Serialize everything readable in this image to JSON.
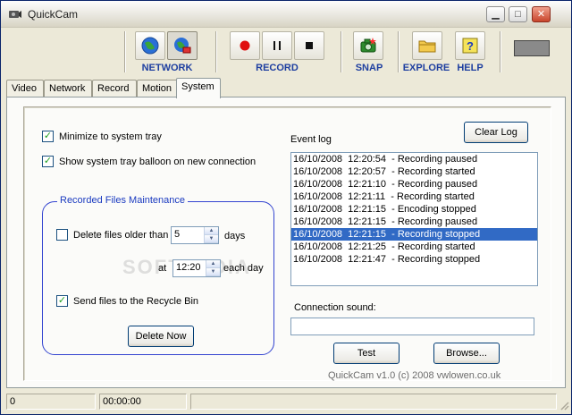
{
  "window": {
    "title": "QuickCam"
  },
  "toolbar": {
    "network_label": "NETWORK",
    "record_label": "RECORD",
    "snap_label": "SNAP",
    "explore_label": "EXPLORE",
    "help_label": "HELP"
  },
  "tabs": [
    {
      "label": "Video"
    },
    {
      "label": "Network"
    },
    {
      "label": "Record"
    },
    {
      "label": "Motion"
    },
    {
      "label": "System",
      "active": true
    }
  ],
  "system": {
    "minimize_to_tray": {
      "label": "Minimize to system tray",
      "checked": true
    },
    "tray_balloon": {
      "label": "Show system tray balloon on new connection",
      "checked": true
    },
    "maintenance": {
      "title": "Recorded Files Maintenance",
      "delete_older": {
        "label": "Delete files older than",
        "checked": false
      },
      "days_value": "5",
      "days_label": "days",
      "at_label": "at",
      "time_value": "12:20",
      "each_day_label": "each day",
      "recycle": {
        "label": "Send files to the Recycle Bin",
        "checked": true
      },
      "delete_now_label": "Delete Now"
    },
    "event_log": {
      "label": "Event log",
      "clear_label": "Clear Log",
      "entries": [
        "16/10/2008  12:20:54  - Recording paused",
        "16/10/2008  12:20:57  - Recording started",
        "16/10/2008  12:21:10  - Recording paused",
        "16/10/2008  12:21:11  - Recording started",
        "16/10/2008  12:21:15  - Encoding stopped",
        "16/10/2008  12:21:15  - Recording paused",
        "16/10/2008  12:21:15  - Recording stopped",
        "16/10/2008  12:21:25  - Recording started",
        "16/10/2008  12:21:47  - Recording stopped"
      ],
      "selected_index": 6
    },
    "connection_sound": {
      "label": "Connection sound:",
      "value": ""
    },
    "test_label": "Test",
    "browse_label": "Browse...",
    "footer": "QuickCam v1.0   (c) 2008 vwlowen.co.uk",
    "watermark": "SOFTPEDIA"
  },
  "statusbar": {
    "cell1": "0",
    "cell2": "00:00:00",
    "cell3": ""
  },
  "colors": {
    "label_blue": "#1e3fa0",
    "selection": "#316ac5",
    "group_border": "#3344d0",
    "record_red": "#e01010"
  }
}
